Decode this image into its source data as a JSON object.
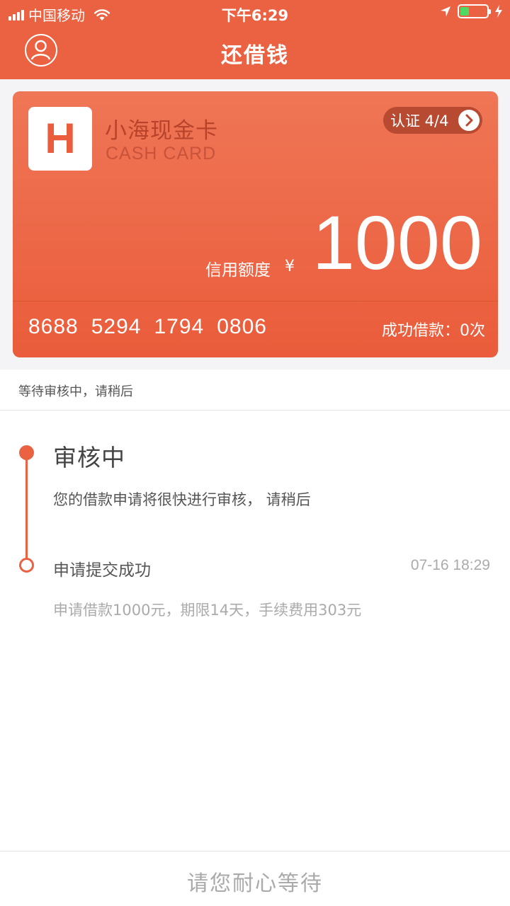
{
  "status_bar": {
    "carrier": "中国移动",
    "time": "下午6:29",
    "battery_color": "#4cd964"
  },
  "nav": {
    "title": "还借钱",
    "avatar_icon": "user-icon"
  },
  "card": {
    "logo_letter": "H",
    "brand_name": "小海现金卡",
    "brand_sub": "CASH CARD",
    "verify_label": "认证 4/4",
    "limit_label": "信用额度",
    "currency": "¥",
    "limit_amount": "1000",
    "number_groups": [
      "8688",
      "5294",
      "1794",
      "0806"
    ],
    "loan_count": "成功借款：0次",
    "accent": "#ea6242"
  },
  "notice": {
    "waiting_text": "等待审核中，请稍后"
  },
  "timeline": {
    "steps": [
      {
        "title": "审核中",
        "desc": "您的借款申请将很快进行审核， 请稍后"
      },
      {
        "title": "申请提交成功",
        "time": "07-16 18:29",
        "desc": "申请借款1000元，期限14天，手续费用303元"
      }
    ]
  },
  "footer": {
    "button_label": "请您耐心等待"
  }
}
